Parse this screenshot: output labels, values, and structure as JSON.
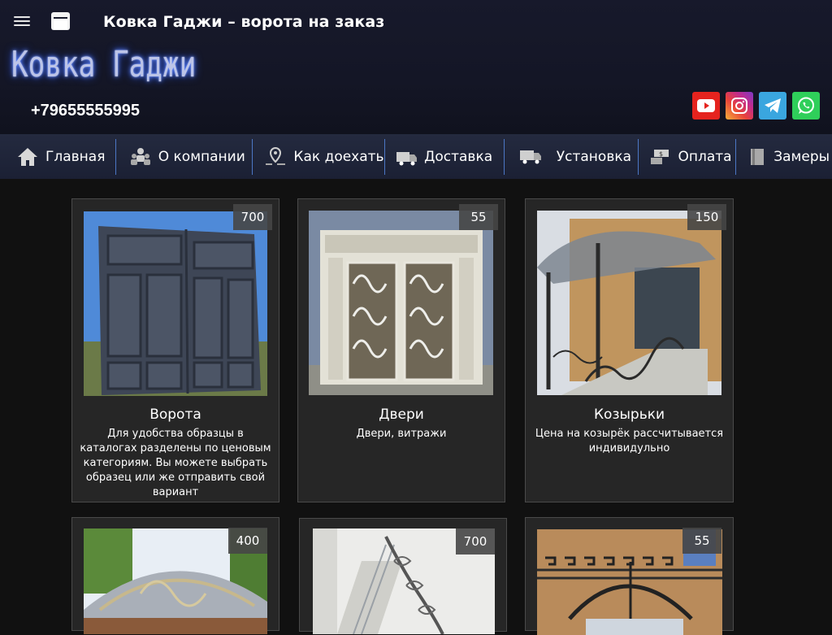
{
  "header": {
    "title": "Ковка Гаджи – ворота на заказ",
    "logo_text": "Ковка Гаджи",
    "phone": "+79655555995",
    "menu_icon": "hamburger-menu-icon",
    "window_icon": "window-icon"
  },
  "socials": [
    {
      "name": "youtube",
      "icon": "youtube-icon",
      "color": "#e5231e"
    },
    {
      "name": "instagram",
      "icon": "instagram-icon",
      "color": "#c22b8c"
    },
    {
      "name": "telegram",
      "icon": "telegram-icon",
      "color": "#3aa6df"
    },
    {
      "name": "whatsapp",
      "icon": "whatsapp-icon",
      "color": "#2fcf5a"
    }
  ],
  "nav": {
    "items": [
      {
        "label": "Главная",
        "icon": "home-icon"
      },
      {
        "label": "О компании",
        "icon": "team-icon"
      },
      {
        "label": "Как доехать",
        "icon": "location-icon"
      },
      {
        "label": "Доставка",
        "icon": "delivery-icon"
      },
      {
        "label": "Установка",
        "icon": "truck-icon"
      },
      {
        "label": "Оплата",
        "icon": "money-icon"
      },
      {
        "label": "Замеры",
        "icon": "book-icon"
      }
    ]
  },
  "cards": [
    {
      "count": "700",
      "title": "Ворота",
      "desc": "Для удобства образцы в каталогах разделены по ценовым категориям. Вы можете выбрать образец или же отправить свой вариант"
    },
    {
      "count": "55",
      "title": "Двери",
      "desc": "Двери, витражи"
    },
    {
      "count": "150",
      "title": "Козырьки",
      "desc": "Цена на козырёк рассчитывается индивидульно"
    },
    {
      "count": "400",
      "title": "",
      "desc": ""
    },
    {
      "count": "700",
      "title": "",
      "desc": ""
    },
    {
      "count": "55",
      "title": "",
      "desc": ""
    }
  ],
  "colors": {
    "header_bg": "#17192b",
    "nav_bg": "#242a3f",
    "nav_separator": "#4c77c5",
    "page_bg": "#111111",
    "card_bg": "#262626",
    "logo_glow": "#2d5bff"
  }
}
